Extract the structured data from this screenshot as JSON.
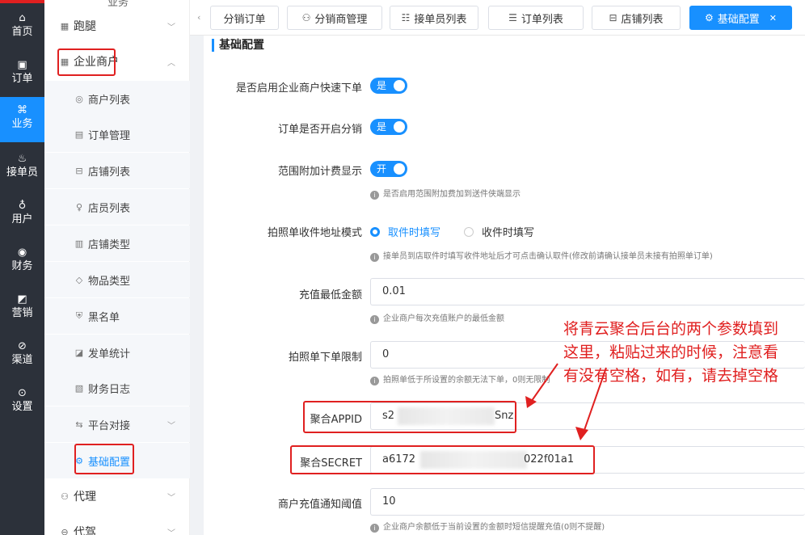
{
  "colors": {
    "accent": "#1890ff",
    "annotation_red": "#e02020",
    "rail_bg": "#2c313a"
  },
  "rail": [
    {
      "icon": "home-icon",
      "glyph": "⌂",
      "label": "首页"
    },
    {
      "icon": "order-icon",
      "glyph": "▣",
      "label": "订单"
    },
    {
      "icon": "business-icon",
      "glyph": "⌘",
      "label": "业务"
    },
    {
      "icon": "bike-icon",
      "glyph": "♨",
      "label": "接单员"
    },
    {
      "icon": "user-icon",
      "glyph": "♁",
      "label": "用户"
    },
    {
      "icon": "finance-icon",
      "glyph": "◉",
      "label": "财务"
    },
    {
      "icon": "marketing-icon",
      "glyph": "◩",
      "label": "营销"
    },
    {
      "icon": "channel-icon",
      "glyph": "⊘",
      "label": "渠道"
    },
    {
      "icon": "settings-icon",
      "glyph": "⊙",
      "label": "设置"
    }
  ],
  "sidebar": {
    "top_partial": "业务",
    "errand": "跑腿",
    "enterprise": "企业商户",
    "items": [
      "商户列表",
      "订单管理",
      "店铺列表",
      "店员列表",
      "店铺类型",
      "物品类型",
      "黑名单",
      "发单统计",
      "财务日志",
      "平台对接",
      "基础配置"
    ],
    "agent": "代理",
    "bottom_partial": "代驾"
  },
  "tabs": [
    "分销订单",
    "分销商管理",
    "接单员列表",
    "订单列表",
    "店铺列表",
    "基础配置"
  ],
  "page": {
    "title": "基础配置",
    "fields": {
      "quick_order": {
        "label": "是否启用企业商户快速下单",
        "value": "是"
      },
      "distribution": {
        "label": "订单是否开启分销",
        "value": "是"
      },
      "range_fee": {
        "label": "范围附加计费显示",
        "value": "开",
        "hint": "是否启用范围附加费加到送件侠端显示"
      },
      "address_mode": {
        "label": "拍照单收件地址模式",
        "opt1": "取件时填写",
        "opt2": "收件时填写",
        "hint": "接单员到店取件时填写收件地址后才可点击确认取件(修改前请确认接单员未接有拍照单订单)"
      },
      "min_recharge": {
        "label": "充值最低金额",
        "value": "0.01",
        "hint": "企业商户每次充值账户的最低金额"
      },
      "photo_limit": {
        "label": "拍照单下单限制",
        "value": "0",
        "hint": "拍照单低于所设置的余额无法下单，0则无限制"
      },
      "appid": {
        "label": "聚合APPID",
        "prefix": "s2",
        "suffix": "Snz"
      },
      "secret": {
        "label": "聚合SECRET",
        "prefix": "a6172",
        "suffix": "022f01a1"
      },
      "notify": {
        "label": "商户充值通知阈值",
        "value": "10",
        "hint": "企业商户余额低于当前设置的金额时短信提醒充值(0则不提醒)"
      }
    }
  },
  "annotation": [
    "将青云聚合后台的两个参数填到",
    "这里，粘贴过来的时候，注意看",
    "有没有空格，如有，请去掉空格"
  ]
}
